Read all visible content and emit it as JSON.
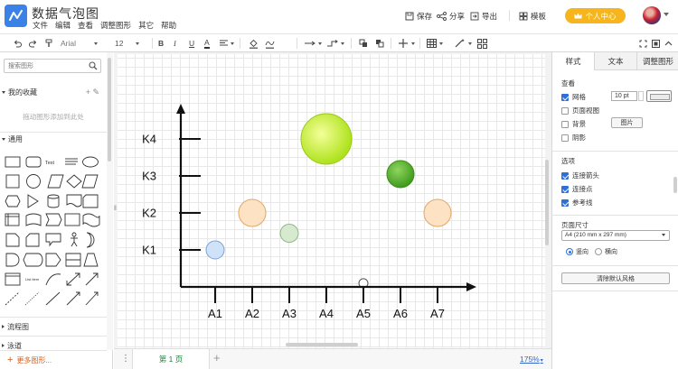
{
  "app": {
    "title": "数据气泡图",
    "menu": [
      "文件",
      "编辑",
      "查看",
      "调整图形",
      "其它",
      "帮助"
    ]
  },
  "header_actions": {
    "save": "保存",
    "share": "分享",
    "export": "导出",
    "template": "模板",
    "vip": "个人中心"
  },
  "toolbar": {
    "font_family": "Arial",
    "font_size": "12"
  },
  "left_panel": {
    "search_placeholder": "搜索图形",
    "favorites_title": "我的收藏",
    "favorites_hint": "拖动图形添加到此处",
    "general_title": "通用",
    "flowchart_title": "流程图",
    "umbrella_title": "泳道",
    "more_shapes": "更多图形..."
  },
  "right_panel": {
    "tabs": [
      "样式",
      "文本",
      "调整图形"
    ],
    "view_label": "查看",
    "grid_label": "网格",
    "grid_size": "10 pt",
    "page_view_label": "页面视图",
    "background_label": "背景",
    "background_button": "图片",
    "shadow_label": "阴影",
    "options_label": "选项",
    "connection_arrows": "连接箭头",
    "connection_points": "连接点",
    "guides": "参考线",
    "page_size_label": "页面尺寸",
    "paper_size": "A4 (210 mm x 297 mm)",
    "portrait": "竖向",
    "landscape": "横向",
    "reset_style": "清除默认风格"
  },
  "footer": {
    "page_tab": "第 1 页",
    "zoom": "175%"
  },
  "chart_data": {
    "type": "scatter",
    "x_categories": [
      "A1",
      "A2",
      "A3",
      "A4",
      "A5",
      "A6",
      "A7"
    ],
    "y_categories": [
      "K1",
      "K2",
      "K3",
      "K4"
    ],
    "bubbles": [
      {
        "x": "A1",
        "y": 1.0,
        "size": "small",
        "color": "#cfe2f7",
        "stroke": "#7aa2d6"
      },
      {
        "x": "A2",
        "y": 2.0,
        "size": "medium",
        "color": "#fde3c4",
        "stroke": "#e0a866"
      },
      {
        "x": "A3",
        "y": 1.45,
        "size": "small",
        "color": "#d7ead0",
        "stroke": "#8fb886"
      },
      {
        "x": "A4",
        "y": 4.0,
        "size": "large",
        "color": "#c6ef2a",
        "stroke": "#9cc81a"
      },
      {
        "x": "A5",
        "y": 0.1,
        "size": "tiny",
        "color": "#ffffff",
        "stroke": "#555555"
      },
      {
        "x": "A6",
        "y": 3.05,
        "size": "medium",
        "color": "#5cb830",
        "stroke": "#3c8c18"
      },
      {
        "x": "A7",
        "y": 2.0,
        "size": "medium",
        "color": "#fde3c4",
        "stroke": "#e0a866"
      }
    ]
  }
}
